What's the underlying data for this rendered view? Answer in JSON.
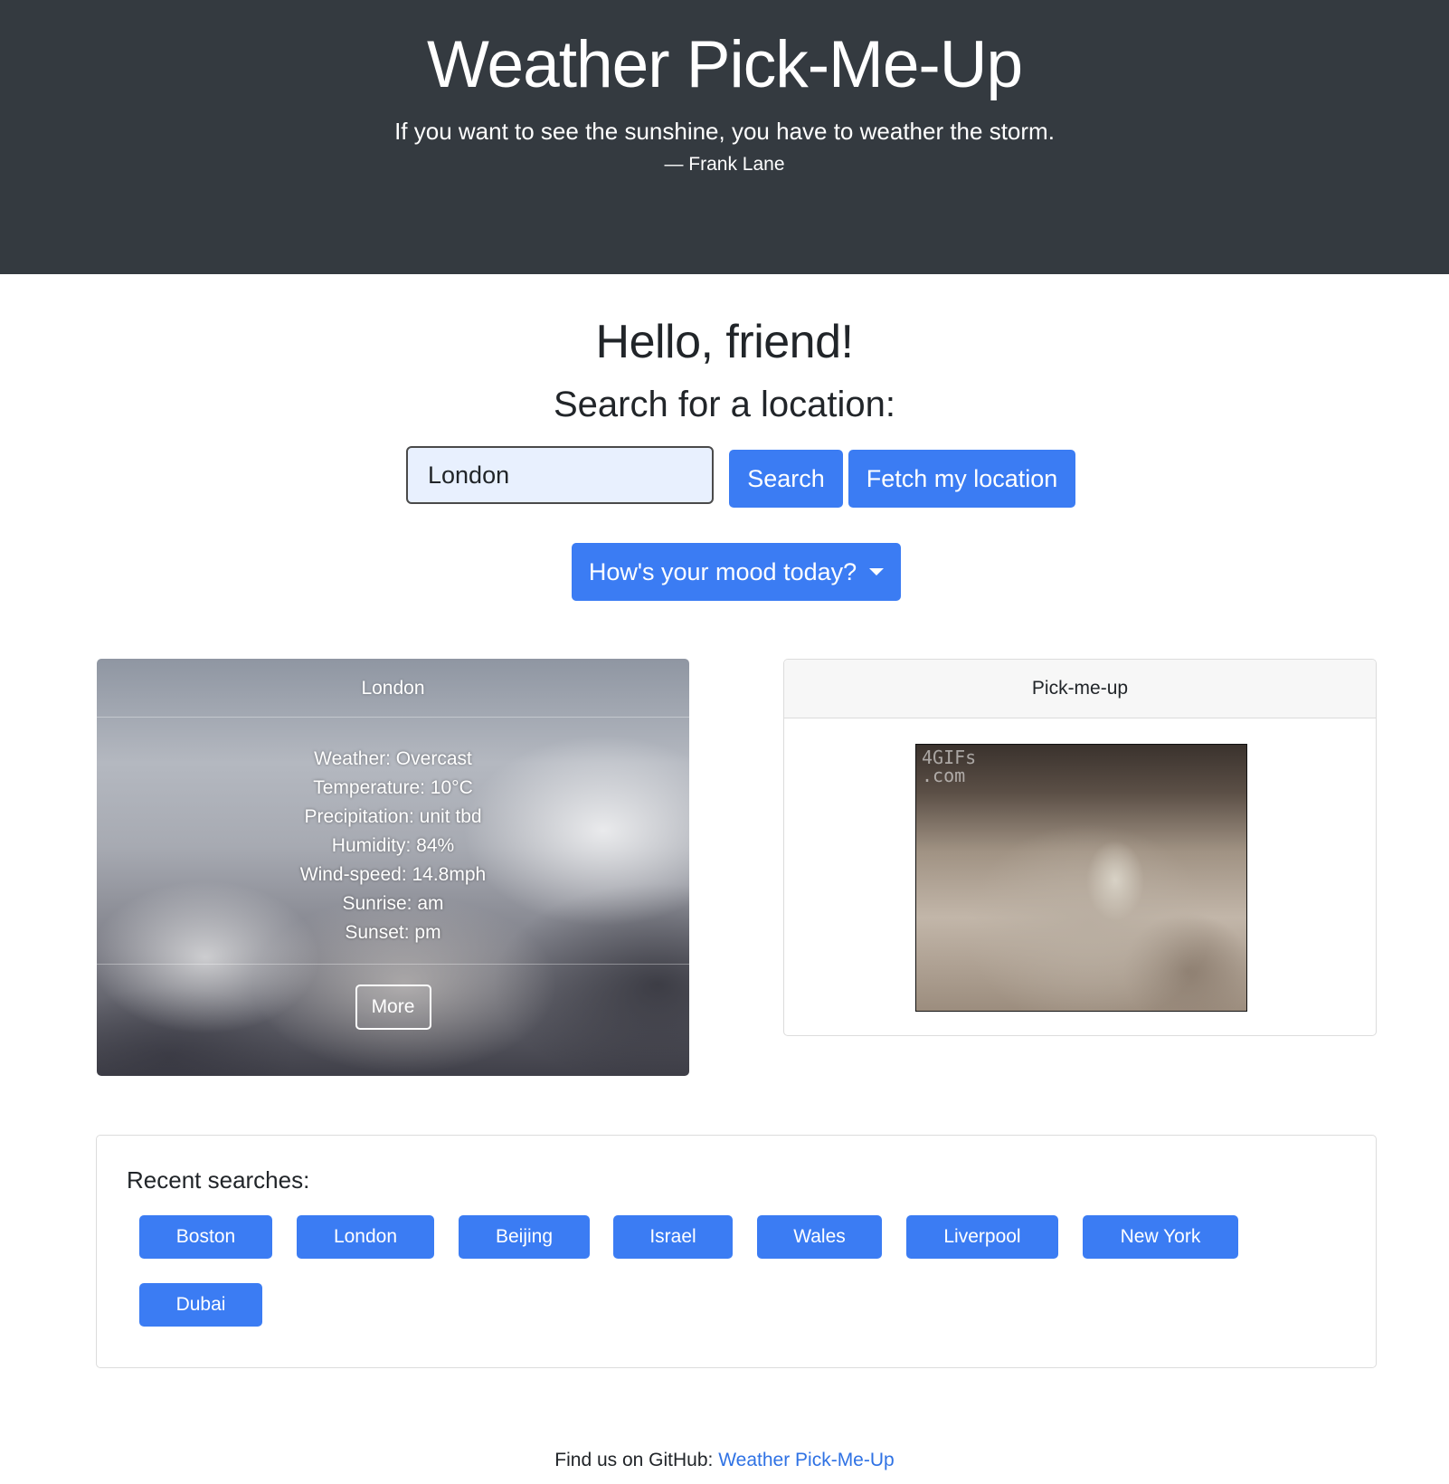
{
  "hero": {
    "title": "Weather Pick-Me-Up",
    "quote": "If you want to see the sunshine, you have to weather the storm.",
    "author": "— Frank Lane"
  },
  "main": {
    "greeting": "Hello, friend!",
    "search_heading": "Search for a location:",
    "search_value": "London",
    "search_button": "Search",
    "fetch_button": "Fetch my location",
    "mood_button": "How's your mood today?"
  },
  "weather_card": {
    "location": "London",
    "lines": [
      "Weather: Overcast",
      "Temperature: 10°C",
      "Precipitation: unit tbd",
      "Humidity: 84%",
      "Wind-speed: 14.8mph",
      "Sunrise: am",
      "Sunset: pm"
    ],
    "more_button": "More"
  },
  "pick_card": {
    "title": "Pick-me-up",
    "watermark": "4GIFs\n.com"
  },
  "recent": {
    "title": "Recent searches:",
    "cities": [
      "Boston",
      "London",
      "Beijing",
      "Israel",
      "Wales",
      "Liverpool",
      "New York",
      "Dubai"
    ]
  },
  "footer": {
    "prefix": "Find us on GitHub: ",
    "link": "Weather Pick-Me-Up"
  },
  "colors": {
    "hero_bg": "#343a40",
    "primary": "#3b7cf3",
    "link": "#2f72e4",
    "input_bg": "#e8f0fe"
  }
}
